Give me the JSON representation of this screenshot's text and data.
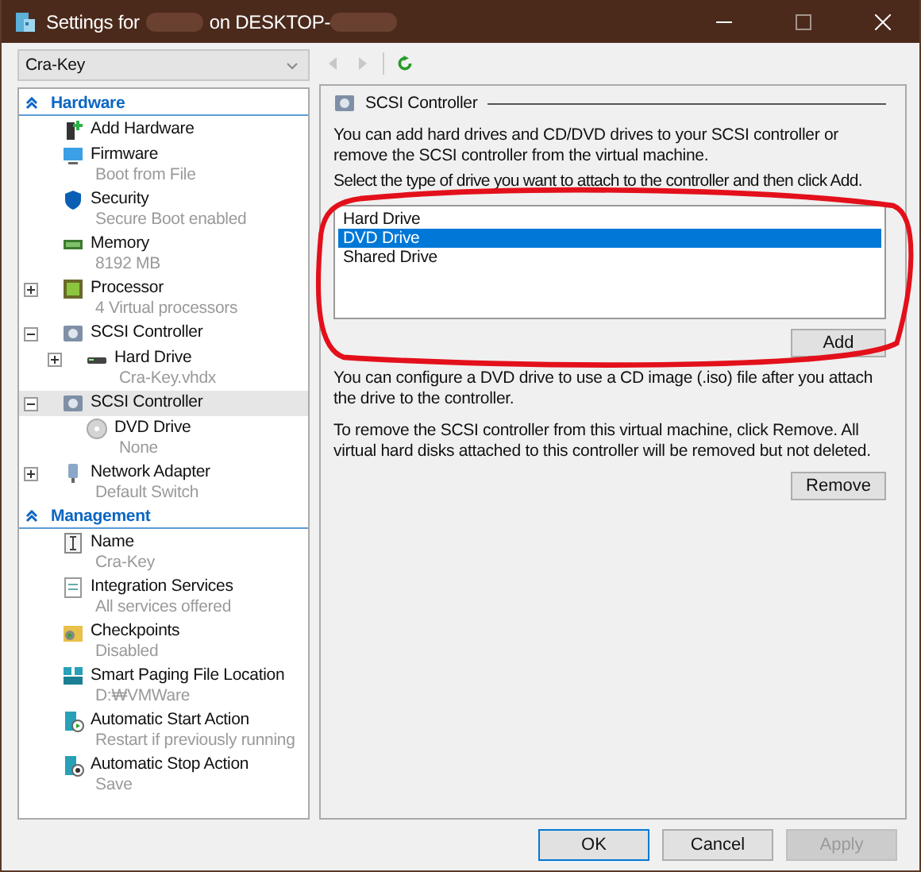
{
  "window": {
    "title_prefix": "Settings for",
    "title_suffix": "on DESKTOP-"
  },
  "vm_selector": {
    "value": "Cra-Key"
  },
  "tree": {
    "sections": [
      {
        "title": "Hardware",
        "items": [
          {
            "kind": "hardware",
            "name": "Add Hardware",
            "selected": false
          },
          {
            "kind": "firmware",
            "name": "Firmware",
            "detail": "Boot from File",
            "selected": false
          },
          {
            "kind": "security",
            "name": "Security",
            "detail": "Secure Boot enabled",
            "selected": false
          },
          {
            "kind": "memory",
            "name": "Memory",
            "detail": "8192 MB",
            "selected": false
          },
          {
            "kind": "processor",
            "name": "Processor",
            "detail": "4 Virtual processors",
            "expanded": false,
            "selected": false
          },
          {
            "kind": "controller",
            "name": "SCSI Controller",
            "expanded": true,
            "selected": false,
            "children": [
              {
                "kind": "disk",
                "name": "Hard Drive",
                "detail": "Cra-Key.vhdx",
                "expanded": false,
                "selected": false
              }
            ]
          },
          {
            "kind": "controller",
            "name": "SCSI Controller",
            "expanded": true,
            "selected": true,
            "children": [
              {
                "kind": "dvd",
                "name": "DVD Drive",
                "detail": "None",
                "selected": false
              }
            ]
          },
          {
            "kind": "network",
            "name": "Network Adapter",
            "detail": "Default Switch",
            "expanded": false,
            "selected": false
          }
        ]
      },
      {
        "title": "Management",
        "items": [
          {
            "kind": "name",
            "name": "Name",
            "detail": "Cra-Key",
            "selected": false
          },
          {
            "kind": "integration",
            "name": "Integration Services",
            "detail": "All services offered",
            "selected": false
          },
          {
            "kind": "checkpoints",
            "name": "Checkpoints",
            "detail": "Disabled",
            "selected": false
          },
          {
            "kind": "paging",
            "name": "Smart Paging File Location",
            "detail": "D:₩VMWare",
            "selected": false
          },
          {
            "kind": "start",
            "name": "Automatic Start Action",
            "detail": "Restart if previously running",
            "selected": false
          },
          {
            "kind": "stop",
            "name": "Automatic Stop Action",
            "detail": "Save",
            "selected": false
          }
        ]
      }
    ]
  },
  "panel": {
    "title": "SCSI Controller",
    "intro": "You can add hard drives and CD/DVD drives to your SCSI controller or remove the SCSI controller from the virtual machine.",
    "list_label": "Select the type of drive you want to attach to the controller and then click Add.",
    "drive_types": [
      {
        "label": "Hard Drive",
        "selected": false
      },
      {
        "label": "DVD Drive",
        "selected": true
      },
      {
        "label": "Shared Drive",
        "selected": false
      }
    ],
    "add_button": "Add",
    "dvd_note": "You can configure a DVD drive to use a CD image (.iso) file after you attach the drive to the controller.",
    "remove_note": "To remove the SCSI controller from this virtual machine, click Remove. All virtual hard disks attached to this controller will be removed but not deleted.",
    "remove_button": "Remove"
  },
  "buttons": [
    {
      "label": "OK",
      "focused": true,
      "disabled": false
    },
    {
      "label": "Cancel",
      "focused": false,
      "disabled": false
    },
    {
      "label": "Apply",
      "focused": false,
      "disabled": true
    }
  ]
}
